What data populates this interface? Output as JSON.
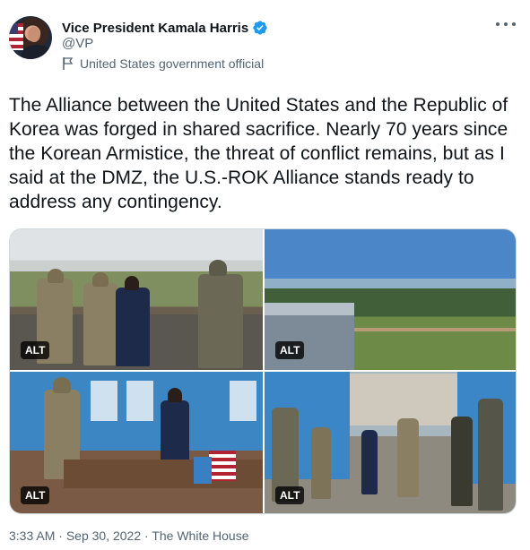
{
  "author": {
    "display_name": "Vice President Kamala Harris",
    "handle": "@VP",
    "label": "United States government official",
    "avatar_icon": "avatar-photo",
    "verified_icon": "verified-badge-icon",
    "verified_color": "#1d9bf0"
  },
  "more_icon": "more-options-icon",
  "tweet": {
    "text": "The Alliance between the United States and the Republic of Korea was forged in shared sacrifice. Nearly 70 years since the Korean Armistice, the threat of conflict remains, but as I said at the DMZ, the U.S.-ROK Alliance stands ready to address any contingency."
  },
  "media": [
    {
      "alt_label": "ALT"
    },
    {
      "alt_label": "ALT"
    },
    {
      "alt_label": "ALT"
    },
    {
      "alt_label": "ALT"
    }
  ],
  "footer": {
    "time": "3:33 AM",
    "separator1": "·",
    "date": "Sep 30, 2022",
    "separator2": "·",
    "source": "The White House"
  },
  "colors": {
    "text_primary": "#0f1419",
    "text_secondary": "#536471",
    "border": "#cfd9de"
  }
}
